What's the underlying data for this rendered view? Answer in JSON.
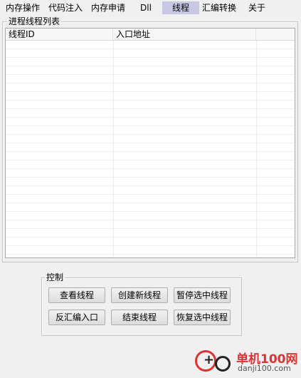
{
  "tabs": [
    {
      "label": "内存操作"
    },
    {
      "label": "代码注入"
    },
    {
      "label": "内存申请"
    },
    {
      "label": "Dll"
    },
    {
      "label": "线程"
    },
    {
      "label": "汇编转换"
    },
    {
      "label": "关于"
    }
  ],
  "active_tab": "线程",
  "thread_group": {
    "legend": "进程线程列表",
    "columns": [
      {
        "label": "线程ID"
      },
      {
        "label": "入口地址"
      },
      {
        "label": ""
      }
    ],
    "rows": []
  },
  "control_group": {
    "legend": "控制",
    "buttons": {
      "view_threads": "查看线程",
      "create_thread": "创建新线程",
      "suspend_selected": "暂停选中线程",
      "disasm_entry": "反汇编入口",
      "end_thread": "结束线程",
      "resume_selected": "恢复选中线程"
    }
  },
  "watermark": {
    "brand": "单机100网",
    "url": "danji100.com"
  },
  "colors": {
    "active_tab_bg": "#c8c8e4",
    "watermark_red": "#dd3333"
  }
}
